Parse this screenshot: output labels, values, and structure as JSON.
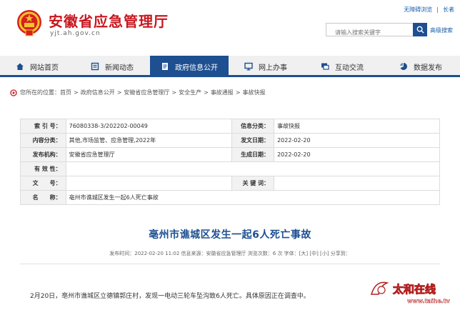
{
  "header": {
    "site_name": "安徽省应急管理厅",
    "site_domain": "yjt.ah.gov.cn",
    "accessibility_link": "无障碍浏览",
    "separator": "|",
    "lang_link": "长者",
    "search_placeholder": "请输入搜索关键字",
    "advanced_search": "高级搜索"
  },
  "nav": {
    "items": [
      {
        "label": "网站首页",
        "icon": "home-icon"
      },
      {
        "label": "新闻动态",
        "icon": "news-icon"
      },
      {
        "label": "政府信息公开",
        "icon": "document-icon"
      },
      {
        "label": "网上办事",
        "icon": "monitor-icon"
      },
      {
        "label": "互动交流",
        "icon": "chat-icon"
      },
      {
        "label": "数据发布",
        "icon": "chart-icon"
      }
    ],
    "active_index": 2
  },
  "breadcrumb": {
    "prefix": "您所在的位置：",
    "items": [
      "首页",
      "政府信息公开",
      "安徽省应急管理厅",
      "安全生产",
      "事故通报",
      "事故快报"
    ],
    "separator": ">"
  },
  "info": {
    "index_label": "索 引 号：",
    "index_value": "76080338-3/202202-00049",
    "category_label": "信息分类：",
    "category_value": "事故快报",
    "content_label": "内容分类：",
    "content_value": "其他,市场监管、应急管理,2022年",
    "issue_date_label": "发文日期：",
    "issue_date_value": "2022-02-20",
    "publisher_label": "发布机构：",
    "publisher_value": "安徽省应急管理厅",
    "gen_date_label": "生成日期：",
    "gen_date_value": "2022-02-20",
    "validity_label": "有 效 性：",
    "validity_value": "",
    "docno_label": "文　　号：",
    "docno_value": "",
    "keyword_label": "关 键 词：",
    "keyword_value": "",
    "name_label": "名　　称：",
    "name_value": "亳州市谯城区发生一起6人死亡事故"
  },
  "article": {
    "title": "亳州市谯城区发生一起6人死亡事故",
    "meta": "发布时间：2022-02-20 11:02   信息来源：安徽省应急管理厅   浏览次数：6 次   字体：[大] [中] [小]   分享到：",
    "body": "2月20日，亳州市谯城区立德镇郭庄村，发现一电动三轮车坠沟致6人死亡。具体原因正在调查中。"
  },
  "watermark": {
    "brand": "太和在线",
    "url": "www.taihe.tv"
  },
  "colors": {
    "brand_red": "#c8161d",
    "nav_blue": "#1d4f91",
    "link_blue": "#1a5fa8"
  }
}
